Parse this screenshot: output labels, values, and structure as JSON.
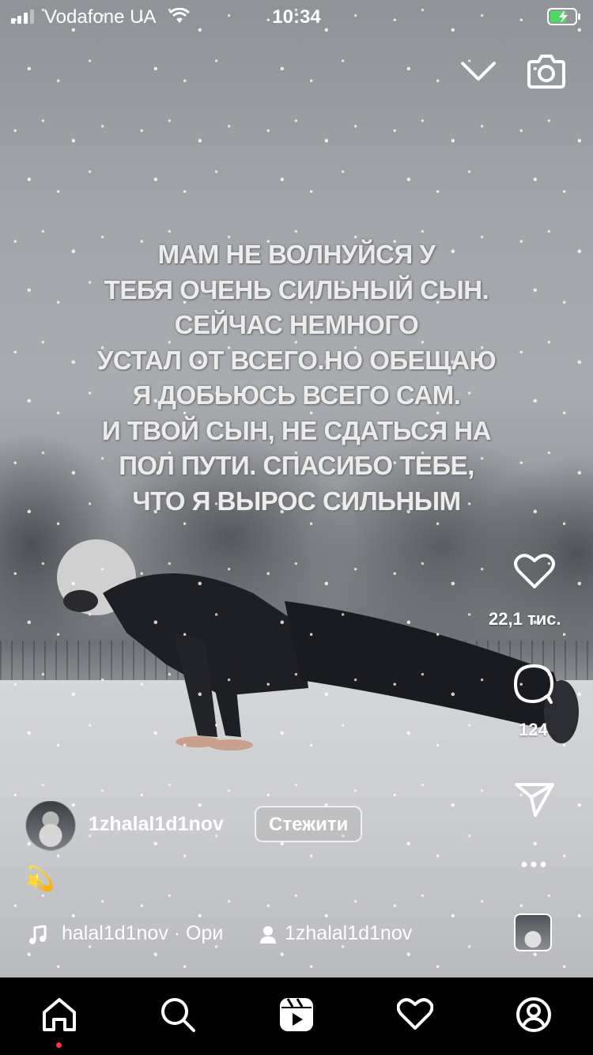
{
  "status_bar": {
    "carrier": "Vodafone UA",
    "time": "10:34",
    "signal_icon": "cellular-signal-icon",
    "wifi_icon": "wifi-icon",
    "battery_icon": "battery-charging-icon"
  },
  "header": {
    "collapse_icon": "chevron-down-icon",
    "camera_icon": "camera-icon"
  },
  "video_overlay_text": [
    "МАМ НЕ ВОЛНУЙСЯ У",
    "ТЕБЯ ОЧЕНЬ СИЛЬНЫЙ СЫН.",
    "СЕЙЧАС НЕМНОГО",
    "УСТАЛ ОТ ВСЕГО.НО ОБЕЩАЮ",
    "Я ДОБЬЮСЬ  ВСЕГО САМ.",
    "И ТВОЙ СЫН, НЕ СДАТЬСЯ НА",
    "ПОЛ ПУТИ. СПАСИБО ТЕБЕ,",
    "ЧТО Я ВЫРОС СИЛЬНЫМ"
  ],
  "actions": {
    "like_count": "22,1 тис.",
    "comment_count": "124"
  },
  "author": {
    "username": "1zhalal1d1nov",
    "follow_label": "Стежити"
  },
  "caption": "💫",
  "music": {
    "track": "halal1d1nov · Ори",
    "tagged_user": "1zhalal1d1nov"
  },
  "accent_color": "#ff3040"
}
